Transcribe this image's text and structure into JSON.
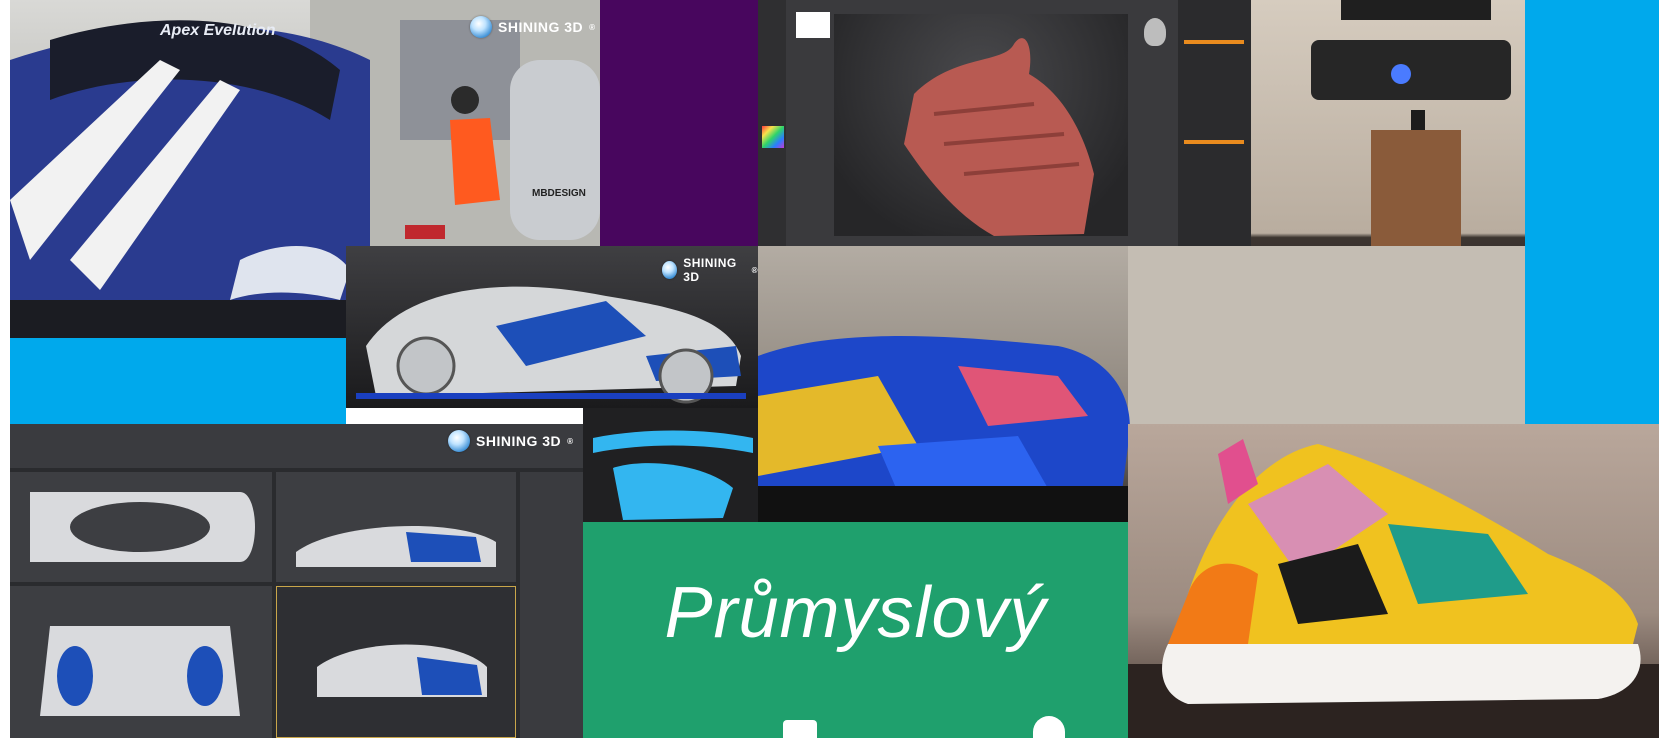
{
  "brand": {
    "logo_text": "SHINING 3D",
    "trademark": "®"
  },
  "photo_text": {
    "windshield_banner": "Apex Evelution",
    "barrel_text": "MBDESIGN"
  },
  "banner": {
    "word": "Průmyslový"
  },
  "colors": {
    "accent_blue": "#00a9ec",
    "accent_purple": "#48065e",
    "accent_green": "#1fa06d",
    "car_blue": "#2a3b8f",
    "shoe_red": "#b85a52"
  },
  "icons": [
    "globe-logo-icon",
    "horse-silhouette-icon",
    "head-bust-icon",
    "color-picker-icon"
  ]
}
